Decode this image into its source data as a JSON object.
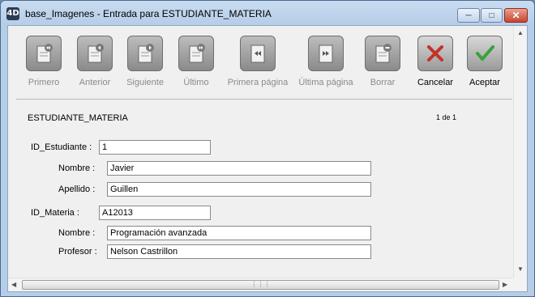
{
  "window": {
    "icon_text": "4D",
    "title": "base_Imagenes - Entrada para ESTUDIANTE_MATERIA"
  },
  "toolbar": {
    "first_label": "Primero",
    "previous_label": "Anterior",
    "next_label": "Siguiente",
    "last_label": "Último",
    "first_page_label": "Primera página",
    "last_page_label": "Última página",
    "delete_label": "Borrar",
    "cancel_label": "Cancelar",
    "accept_label": "Aceptar"
  },
  "form": {
    "table_name": "ESTUDIANTE_MATERIA",
    "record_count": "1 de 1",
    "id_estudiante_label": "ID_Estudiante :",
    "id_estudiante_value": "1",
    "nombre_estudiante_label": "Nombre :",
    "nombre_estudiante_value": "Javier",
    "apellido_label": "Apellido :",
    "apellido_value": "Guillen",
    "id_materia_label": "ID_Materia :",
    "id_materia_value": "A12013",
    "nombre_materia_label": "Nombre :",
    "nombre_materia_value": "Programación avanzada",
    "profesor_label": "Profesor :",
    "profesor_value": "Nelson Castrillon"
  },
  "colors": {
    "accept_check": "#3aa13a",
    "cancel_x": "#c4312a"
  }
}
